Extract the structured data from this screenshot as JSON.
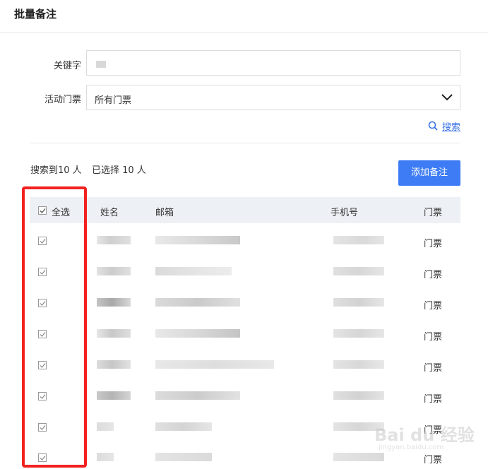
{
  "header": {
    "title": "批量备注"
  },
  "form": {
    "keyword_label": "关键字",
    "ticket_label": "活动门票",
    "ticket_selected": "所有门票",
    "search_label": "搜索"
  },
  "summary": {
    "found": "搜索到10 人",
    "selected": "已选择 10 人"
  },
  "add_button": "添加备注",
  "table": {
    "headers": {
      "select_all": "全选",
      "name": "姓名",
      "email": "邮箱",
      "phone": "手机号",
      "ticket": "门票"
    },
    "rows": [
      {
        "ticket": "门票",
        "checked": true
      },
      {
        "ticket": "门票",
        "checked": true
      },
      {
        "ticket": "门票",
        "checked": true
      },
      {
        "ticket": "门票",
        "checked": true
      },
      {
        "ticket": "门票",
        "checked": true
      },
      {
        "ticket": "门票",
        "checked": true
      },
      {
        "ticket": "门票",
        "checked": true
      },
      {
        "ticket": "门票",
        "checked": true
      }
    ]
  },
  "watermark": {
    "brand": "Bai du 经验",
    "url": "jingyan.baidu.com"
  },
  "colors": {
    "primary": "#3d7cf4",
    "highlight_frame": "#f2211f",
    "link": "#3b74e7"
  }
}
